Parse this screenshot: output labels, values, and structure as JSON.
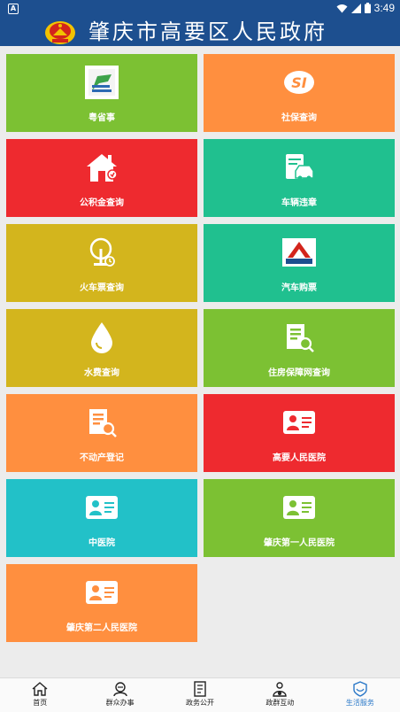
{
  "status_bar": {
    "time": "3:49",
    "app_glyph": "A"
  },
  "header": {
    "title": "肇庆市高要区人民政府"
  },
  "tiles": [
    {
      "label": "粤省事",
      "icon": "yueshengshi-logo",
      "color": "#7cc133"
    },
    {
      "label": "社保查询",
      "icon": "social-security-logo",
      "color": "#ff8f3f"
    },
    {
      "label": "公积金查询",
      "icon": "house-icon",
      "color": "#ee2a2f"
    },
    {
      "label": "车辆违章",
      "icon": "vehicle-document-icon",
      "color": "#20c08f"
    },
    {
      "label": "火车票查询",
      "icon": "train-ticket-icon",
      "color": "#d3b51d"
    },
    {
      "label": "汽车购票",
      "icon": "guangdong-transport-logo",
      "color": "#20c08f"
    },
    {
      "label": "水费查询",
      "icon": "water-drop-icon",
      "color": "#d3b51d"
    },
    {
      "label": "住房保障网查询",
      "icon": "document-search-icon",
      "color": "#7cc133"
    },
    {
      "label": "不动产登记",
      "icon": "document-search-icon",
      "color": "#ff8f3f"
    },
    {
      "label": "高要人民医院",
      "icon": "doctor-id-card-icon",
      "color": "#ee2a2f"
    },
    {
      "label": "中医院",
      "icon": "doctor-id-card-icon",
      "color": "#22c1c8"
    },
    {
      "label": "肇庆第一人民医院",
      "icon": "doctor-id-card-icon",
      "color": "#7cc133"
    },
    {
      "label": "肇庆第二人民医院",
      "icon": "doctor-id-card-icon",
      "color": "#ff8f3f"
    }
  ],
  "bottom_nav": [
    {
      "label": "首页",
      "icon": "home-icon",
      "active": false
    },
    {
      "label": "群众办事",
      "icon": "people-service-icon",
      "active": false
    },
    {
      "label": "政务公开",
      "icon": "document-list-icon",
      "active": false
    },
    {
      "label": "政群互动",
      "icon": "interaction-icon",
      "active": false
    },
    {
      "label": "生活服务",
      "icon": "life-service-icon",
      "active": true
    }
  ],
  "colors": {
    "header": "#1d4f8f",
    "nav_active": "#2a78c8",
    "background": "#ececec"
  }
}
